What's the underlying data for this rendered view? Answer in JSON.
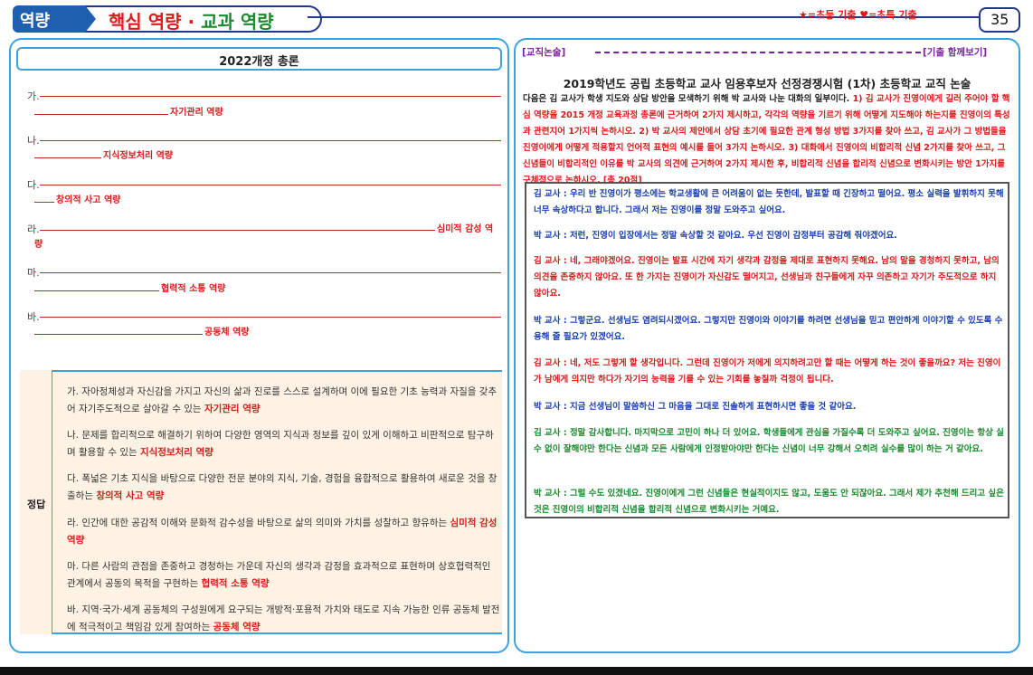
{
  "header": {
    "tab": "역량",
    "title_red": "핵심 역량",
    "title_sep": " · ",
    "title_green": "교과 역량",
    "legend": "★=초등 기출 ♥=초특 기출",
    "page": "35"
  },
  "left": {
    "title": "2022개정 총론",
    "questions": [
      {
        "letter": "가.",
        "answer": "자기관리 역량"
      },
      {
        "letter": "나.",
        "answer": "지식정보처리 역량"
      },
      {
        "letter": "다.",
        "answer": "창의적 사고 역량"
      },
      {
        "letter": "라.",
        "answer_a": "심미적 감성 역",
        "answer_b": "량"
      },
      {
        "letter": "마.",
        "answer": "협력적 소통 역량"
      },
      {
        "letter": "바.",
        "answer": "공동체 역량"
      }
    ],
    "answer_label": "정답",
    "answers": [
      {
        "text": "가. 자아정체성과 자신감을 가지고 자신의 삶과 진로를 스스로 설계하며 이에 필요한 기초 능력과 자질을 갖추어 자기주도적으로 살아갈 수 있는 ",
        "hl": "자기관리 역량"
      },
      {
        "text": "나. 문제를 합리적으로 해결하기 위하여 다양한 영역의 지식과 정보를 깊이 있게 이해하고 비판적으로 탐구하며 활용할 수 있는 ",
        "hl": "지식정보처리 역량"
      },
      {
        "text": "다. 폭넓은 기초 지식을 바탕으로 다양한 전문 분야의 지식, 기술, 경험을 융합적으로 활용하여 새로운 것을 창출하는 ",
        "hl": "창의적 사고 역량"
      },
      {
        "text": "라. 인간에 대한 공감적 이해와 문화적 감수성을 바탕으로 삶의 의미와 가치를 성찰하고 향유하는 ",
        "hl": "심미적 감성 역량"
      },
      {
        "text": "마. 다른 사람의 관점을 존중하고 경청하는 가운데 자신의 생각과 감정을 효과적으로 표현하며 상호협력적인 관계에서 공동의 목적을 구현하는 ",
        "hl": "협력적 소통 역량"
      },
      {
        "text": "바. 지역·국가·세계 공동체의 구성원에게 요구되는 개방적·포용적 가치와 태도로 지속 가능한 인류 공동체 발전에 적극적이고 책임감 있게 참여하는 ",
        "hl": "공동체 역량"
      }
    ]
  },
  "right": {
    "hdr_left": "[교직논술]",
    "hdr_right": "[기출 함께보기]",
    "title": "2019학년도 공립 초등학교 교사 임용후보자 선정경쟁시험 (1차) 초등학교 교직 논술",
    "intro_a": "다음은 김 교사가 학생 지도와 상담 방안을 모색하기 위해 박 교사와 나눈 대화의 일부이다. ",
    "intro_b": "1) 김 교사가 진영이에게 길러 주어야 할 핵심 역량을 2015 개정 교육과정 총론에 근거하여 2가지 제시하고, 각각의 역량을 기르기 위해 어떻게 지도해야 하는지를 진영이의 특성과 관련지어 1가지씩 논하시오. 2) 박 교사의 제안에서 상담 초기에 필요한 관계 형성 방법 3가지를 찾아 쓰고, 김 교사가 그 방법들을 진영이에게 어떻게 적용할지 언어적 표현의 예시를 들어 3가지 논하시오. 3) 대화에서 진영이의 비합리적 신념 2가지를 찾아 쓰고, 그 신념들이 비합리적인 이유를 박 교사의 의견에 근거하여 2가지 제시한 후, 비합리적 신념을 합리적 신념으로 변화시키는 방안 1가지를 구체적으로 논하시오. [총 20점]",
    "dialogue": [
      {
        "text": "김 교사 : 우리 반 진영이가 평소에는 학교생활에 큰 어려움이 없는 듯한데, 발표할 때 긴장하고 떨어요. 평소 실력을 발휘하지 못해 너무 속상하다고 합니다. 그래서 저는 진영이를 정말 도와주고 싶어요."
      },
      {
        "text": "박 교사 : 저런, 진영이 입장에서는 정말 속상할 것 같아요. 우선 진영이 감정부터 공감해 줘야겠어요."
      },
      {
        "text": "김 교사 : 네, 그래야겠어요. 진영이는 발표 시간에 자기 생각과 감정을 제대로 표현하지 못해요. 남의 말을 경청하지 못하고, 남의 의견을 존중하지 않아요. 또 한 가지는 진영이가 자신감도 떨어지고, 선생님과 친구들에게 자꾸 의존하고 자기가 주도적으로 하지 않아요."
      },
      {
        "text": "박 교사 : 그렇군요. 선생님도 염려되시겠어요. 그렇지만 진영이와 이야기를 하려면 선생님을 믿고 편안하게 이야기할 수 있도록 수용해 줄 필요가 있겠어요."
      },
      {
        "text": "김 교사 : 네, 저도 그렇게 할 생각입니다. 그런데 진영이가 저에게 의지하려고만 할 때는 어떻게 하는 것이 좋을까요? 저는 진영이가 남에게 의지만 하다가 자기의 능력을 기를 수 있는 기회를 놓칠까 걱정이 됩니다."
      },
      {
        "text": "박 교사 : 지금 선생님이 말씀하신 그 마음을 그대로 진솔하게 표현하시면 좋을 것 같아요."
      },
      {
        "text": "김 교사 : 정말 감사합니다. 마지막으로 고민이 하나 더 있어요. 학생들에게 관심을 가질수록 더 도와주고 싶어요. 진영이는 항상 실수 없이 잘해야만 한다는 신념과 모든 사람에게 인정받아야만 한다는 신념이 너무 강해서 오히려 실수를 많이 하는 거 같아요."
      },
      {
        "text": "박 교사 : 그럴 수도 있겠네요. 진영이에게 그런 신념들은 현실적이지도 않고, 도움도 안 되잖아요. 그래서 제가 추천해 드리고 싶은 것은 진영이의 비합리적 신념을 합리적 신념으로 변화시키는 거예요."
      }
    ]
  }
}
